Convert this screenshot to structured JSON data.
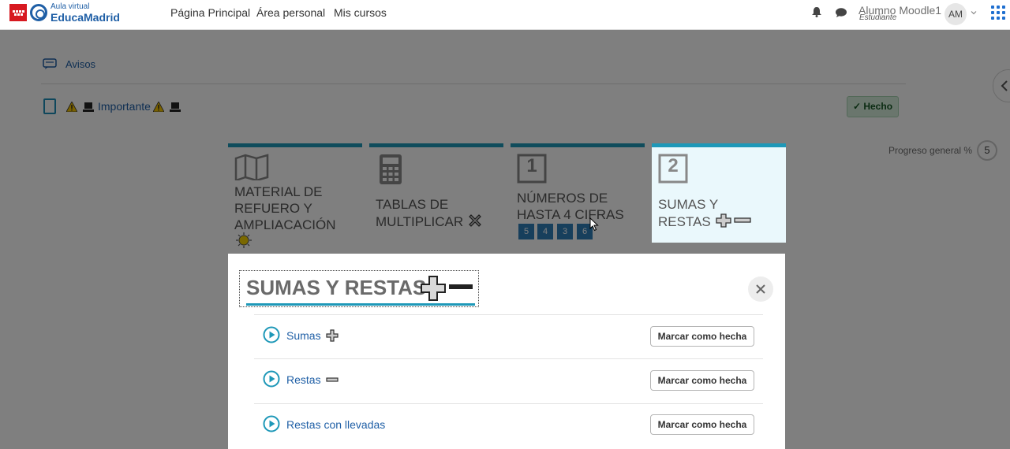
{
  "header": {
    "logo_small": "Aula virtual",
    "logo_big": "EducaMadrid",
    "nav": [
      "Página Principal",
      "Área personal",
      "Mis cursos"
    ],
    "user_name": "Alumno Moodle1",
    "user_role": "Estudiante",
    "avatar_initials": "AM"
  },
  "page": {
    "avisos_label": "Avisos",
    "importante_label": "Importante",
    "hecho_label": "Hecho",
    "progreso_label": "Progreso general %",
    "progreso_value": "5"
  },
  "tiles": [
    {
      "title_lines": [
        "MATERIAL DE",
        "REFUERO Y",
        "AMPLIACACIÓN"
      ]
    },
    {
      "title_lines": [
        "TABLAS DE",
        "MULTIPLICAR"
      ]
    },
    {
      "title_lines": [
        "NÚMEROS DE",
        "HASTA 4 CIFRAS"
      ],
      "number": "1",
      "badges": [
        "5",
        "4",
        "3",
        "6"
      ]
    },
    {
      "title_lines": [
        "SUMAS Y",
        "RESTAS"
      ],
      "number": "2"
    }
  ],
  "modal": {
    "title": "SUMAS Y RESTAS",
    "activities": [
      {
        "label": "Sumas",
        "button": "Marcar como hecha"
      },
      {
        "label": "Restas",
        "button": "Marcar como hecha"
      },
      {
        "label": "Restas con llevadas",
        "button": "Marcar como hecha"
      }
    ]
  },
  "colors": {
    "accent": "#1e98b8",
    "link": "#1f5fa6",
    "done": "#d4edda",
    "brand_red": "#d71920"
  }
}
